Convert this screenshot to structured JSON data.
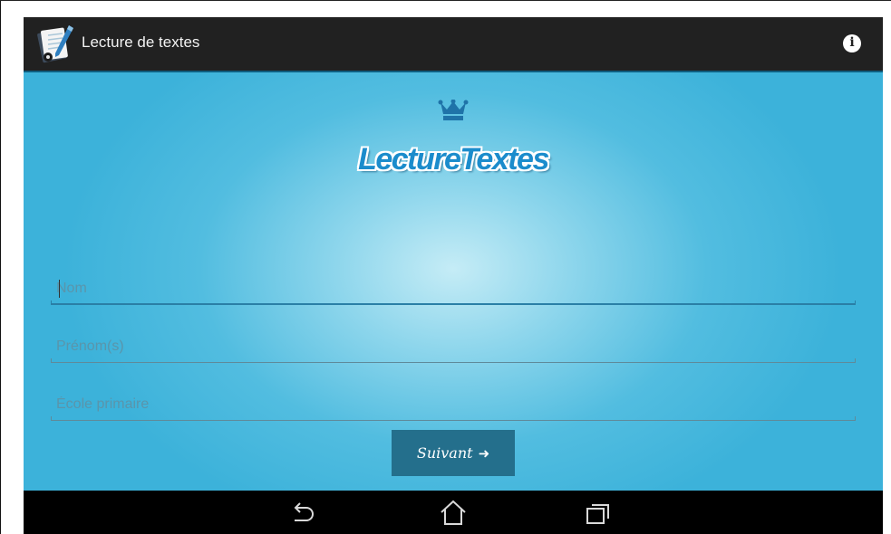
{
  "app": {
    "title": "Lecture de textes",
    "logo_text": "LectureTextes"
  },
  "form": {
    "nom_placeholder": "Nom",
    "prenom_placeholder": "Prénom(s)",
    "ecole_placeholder": "École primaire",
    "next_label": "Suivant",
    "next_arrow": "➜"
  },
  "icons": {
    "app": "notebook-pen-icon",
    "info": "info-icon",
    "crown": "crown-icon",
    "back": "back-icon",
    "home": "home-icon",
    "recents": "recent-apps-icon"
  },
  "colors": {
    "actionbar": "#212121",
    "content_bg": "#3cb2da",
    "button": "#246f8c",
    "logo": "#1b8ccc"
  }
}
